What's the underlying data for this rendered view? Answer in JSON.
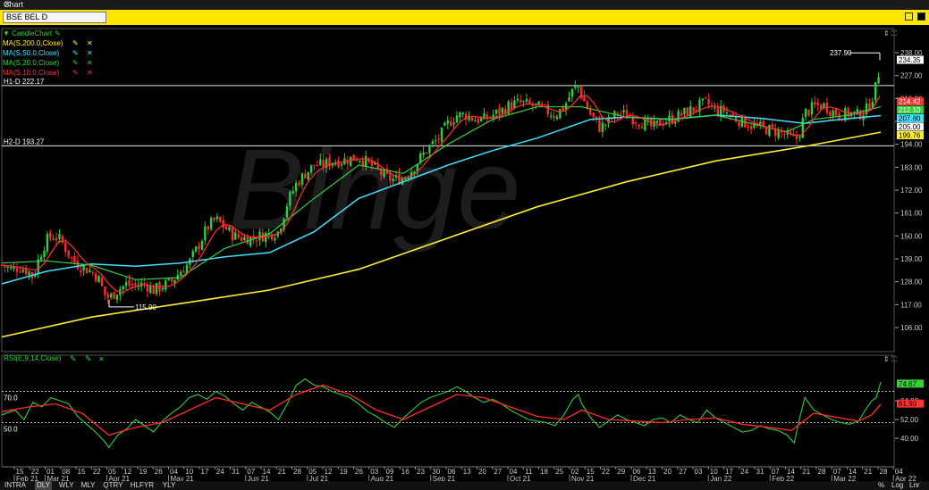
{
  "window": {
    "title": "Chart"
  },
  "symbol": "BSE BEL D",
  "watermark": "Binge",
  "legend": [
    {
      "label": "CandleChart",
      "color": "#38d038",
      "prefix": "▼"
    },
    {
      "label": "MA(S,200.0,Close)",
      "color": "#ffee33"
    },
    {
      "label": "MA(S,50.0,Close)",
      "color": "#40e0ff"
    },
    {
      "label": "MA(S,20.0,Close)",
      "color": "#38d038"
    },
    {
      "label": "MA(S,10.0,Close)",
      "color": "#ff3030"
    }
  ],
  "hlines": [
    {
      "label": "H1-D 222.17",
      "value": 222.17
    },
    {
      "label": "H2-D 193.27",
      "value": 193.27
    }
  ],
  "rsi_legend": "RSI(E,9,14,Close)",
  "rsi_levels": [
    {
      "label": "70.0",
      "value": 70
    },
    {
      "label": "50.0",
      "value": 50
    }
  ],
  "bottom": {
    "buttons": [
      "INTRA",
      "DLY",
      "WLY",
      "MLY",
      "QTRY",
      "HLFYR",
      "YLY"
    ],
    "selected": "DLY",
    "right": [
      "%",
      "Log",
      "Lnr"
    ]
  },
  "chart_data": [
    {
      "type": "candlestick",
      "title": "BSE BEL D",
      "ylim": [
        100,
        242
      ],
      "yticks": [
        "238.00",
        "227.00",
        "216.00",
        "205.00",
        "194.00",
        "183.00",
        "172.00",
        "161.00",
        "150.00",
        "139.00",
        "128.00",
        "117.00",
        "106.00"
      ],
      "price_labels": [
        {
          "text": "234.35",
          "value": 234.35,
          "bg": "#ffffff",
          "fg": "#000000"
        },
        {
          "text": "214.42",
          "value": 214.42,
          "bg": "#ff3030",
          "fg": "#ffffff"
        },
        {
          "text": "212.10",
          "value": 212.1,
          "bg": "#38d038",
          "fg": "#ffffff"
        },
        {
          "text": "207.80",
          "value": 207.8,
          "bg": "#40e0ff",
          "fg": "#000000"
        },
        {
          "text": "205.00",
          "value": 205.0,
          "bg": "#ffffff",
          "fg": "#000000"
        },
        {
          "text": "199.76",
          "value": 199.76,
          "bg": "#ffee33",
          "fg": "#000000"
        }
      ],
      "annotations": [
        {
          "text": "237.90",
          "value": 237.9
        },
        {
          "text": "115.90",
          "value": 115.9
        }
      ],
      "x_day_labels": [
        "15",
        "22",
        "01",
        "08",
        "15",
        "22",
        "05",
        "12",
        "19",
        "26",
        "04",
        "10",
        "17",
        "24",
        "31",
        "07",
        "14",
        "21",
        "28",
        "05",
        "12",
        "19",
        "26",
        "03",
        "09",
        "16",
        "23",
        "30",
        "06",
        "13",
        "20",
        "27",
        "04",
        "11",
        "18",
        "25",
        "02",
        "15",
        "22",
        "29",
        "06",
        "13",
        "20",
        "27",
        "03",
        "10",
        "17",
        "24",
        "31",
        "07",
        "14",
        "21",
        "28",
        "07",
        "14",
        "21",
        "28",
        "04"
      ],
      "x_month_labels": [
        {
          "text": "Feb 21",
          "after": 0
        },
        {
          "text": "Mar 21",
          "after": 2
        },
        {
          "text": "Apr 21",
          "after": 6
        },
        {
          "text": "May 21",
          "after": 10
        },
        {
          "text": "Jun 21",
          "after": 15
        },
        {
          "text": "Jul 21",
          "after": 19
        },
        {
          "text": "Aug 21",
          "after": 23
        },
        {
          "text": "Sep 21",
          "after": 27
        },
        {
          "text": "Oct 21",
          "after": 32
        },
        {
          "text": "Nov 21",
          "after": 36
        },
        {
          "text": "Dec 21",
          "after": 40
        },
        {
          "text": "Jan 22",
          "after": 45
        },
        {
          "text": "Feb 22",
          "after": 49
        },
        {
          "text": "Mar 22",
          "after": 53
        },
        {
          "text": "Apr 22",
          "after": 57
        }
      ],
      "close_path": [
        [
          0,
          136
        ],
        [
          10,
          134
        ],
        [
          20,
          135
        ],
        [
          30,
          133
        ],
        [
          35,
          130
        ],
        [
          42,
          140
        ],
        [
          50,
          148
        ],
        [
          58,
          150
        ],
        [
          66,
          148
        ],
        [
          74,
          142
        ],
        [
          80,
          138
        ],
        [
          90,
          135
        ],
        [
          100,
          133
        ],
        [
          108,
          130
        ],
        [
          115,
          122
        ],
        [
          120,
          120
        ],
        [
          130,
          124
        ],
        [
          140,
          127
        ],
        [
          150,
          126
        ],
        [
          160,
          127
        ],
        [
          170,
          124
        ],
        [
          180,
          126
        ],
        [
          190,
          128
        ],
        [
          200,
          133
        ],
        [
          210,
          137
        ],
        [
          220,
          145
        ],
        [
          230,
          154
        ],
        [
          240,
          158
        ],
        [
          250,
          154
        ],
        [
          260,
          150
        ],
        [
          270,
          149
        ],
        [
          280,
          149
        ],
        [
          290,
          150
        ],
        [
          300,
          151
        ],
        [
          310,
          152
        ],
        [
          320,
          166
        ],
        [
          330,
          175
        ],
        [
          340,
          180
        ],
        [
          350,
          184
        ],
        [
          360,
          184
        ],
        [
          370,
          186
        ],
        [
          380,
          186
        ],
        [
          390,
          187
        ],
        [
          400,
          188
        ],
        [
          410,
          185
        ],
        [
          420,
          182
        ],
        [
          430,
          178
        ],
        [
          440,
          177
        ],
        [
          450,
          178
        ],
        [
          460,
          182
        ],
        [
          470,
          188
        ],
        [
          480,
          193
        ],
        [
          490,
          197
        ],
        [
          500,
          204
        ],
        [
          510,
          208
        ],
        [
          520,
          208
        ],
        [
          530,
          206
        ],
        [
          540,
          206
        ],
        [
          550,
          208
        ],
        [
          560,
          210
        ],
        [
          570,
          213
        ],
        [
          580,
          214
        ],
        [
          590,
          213
        ],
        [
          600,
          212
        ],
        [
          610,
          210
        ],
        [
          620,
          208
        ],
        [
          630,
          212
        ],
        [
          640,
          220
        ],
        [
          646,
          222
        ],
        [
          650,
          217
        ],
        [
          660,
          208
        ],
        [
          670,
          202
        ],
        [
          680,
          205
        ],
        [
          690,
          209
        ],
        [
          700,
          208
        ],
        [
          710,
          206
        ],
        [
          720,
          204
        ],
        [
          730,
          202
        ],
        [
          740,
          205
        ],
        [
          750,
          206
        ],
        [
          760,
          208
        ],
        [
          770,
          210
        ],
        [
          780,
          212
        ],
        [
          790,
          214
        ],
        [
          800,
          210
        ],
        [
          810,
          210
        ],
        [
          820,
          207
        ],
        [
          830,
          205
        ],
        [
          840,
          203
        ],
        [
          850,
          202
        ],
        [
          860,
          201
        ],
        [
          870,
          200
        ],
        [
          880,
          198
        ],
        [
          890,
          196
        ],
        [
          895,
          201
        ],
        [
          900,
          209
        ],
        [
          910,
          212
        ],
        [
          920,
          213
        ],
        [
          930,
          210
        ],
        [
          940,
          208
        ],
        [
          950,
          209
        ],
        [
          960,
          208
        ],
        [
          970,
          211
        ],
        [
          975,
          216
        ],
        [
          980,
          222
        ],
        [
          985,
          234
        ]
      ],
      "ma200_path": [
        [
          0,
          101.5
        ],
        [
          100,
          111
        ],
        [
          200,
          117.5
        ],
        [
          300,
          124
        ],
        [
          400,
          134
        ],
        [
          500,
          149
        ],
        [
          600,
          164
        ],
        [
          700,
          176
        ],
        [
          800,
          186
        ],
        [
          900,
          193
        ],
        [
          985,
          199.8
        ]
      ],
      "ma50_path": [
        [
          0,
          127
        ],
        [
          50,
          133
        ],
        [
          100,
          136.5
        ],
        [
          150,
          135.5
        ],
        [
          200,
          137
        ],
        [
          250,
          140
        ],
        [
          300,
          142
        ],
        [
          350,
          152
        ],
        [
          400,
          168
        ],
        [
          450,
          176
        ],
        [
          500,
          184
        ],
        [
          550,
          191
        ],
        [
          600,
          197
        ],
        [
          660,
          206
        ],
        [
          700,
          207
        ],
        [
          750,
          206
        ],
        [
          800,
          208
        ],
        [
          850,
          206.5
        ],
        [
          900,
          204
        ],
        [
          940,
          206
        ],
        [
          985,
          207.8
        ]
      ],
      "ma20_path": [
        [
          0,
          137
        ],
        [
          50,
          138
        ],
        [
          100,
          136
        ],
        [
          150,
          129
        ],
        [
          200,
          130
        ],
        [
          250,
          144
        ],
        [
          300,
          151
        ],
        [
          350,
          168
        ],
        [
          400,
          184
        ],
        [
          450,
          180
        ],
        [
          500,
          194
        ],
        [
          550,
          206
        ],
        [
          600,
          212
        ],
        [
          650,
          212
        ],
        [
          700,
          207
        ],
        [
          750,
          206
        ],
        [
          800,
          208
        ],
        [
          850,
          203
        ],
        [
          880,
          200
        ],
        [
          910,
          206
        ],
        [
          950,
          208
        ],
        [
          985,
          212.1
        ]
      ]
    },
    {
      "type": "line",
      "title": "RSI(E,9,14,Close)",
      "ylim": [
        30,
        82
      ],
      "yticks": [
        "64.00",
        "52.00",
        "40.00"
      ],
      "price_labels": [
        {
          "text": "74.67",
          "value": 74.67,
          "bg": "#38d038",
          "fg": "#000000"
        },
        {
          "text": "61.90",
          "value": 61.9,
          "bg": "#ff3030",
          "fg": "#000000"
        }
      ],
      "rsi_path": [
        [
          0,
          55
        ],
        [
          15,
          58
        ],
        [
          25,
          52
        ],
        [
          35,
          63
        ],
        [
          45,
          60
        ],
        [
          55,
          66
        ],
        [
          65,
          64
        ],
        [
          75,
          62
        ],
        [
          85,
          54
        ],
        [
          95,
          49
        ],
        [
          105,
          44
        ],
        [
          115,
          38
        ],
        [
          120,
          34
        ],
        [
          130,
          42
        ],
        [
          140,
          46
        ],
        [
          150,
          52
        ],
        [
          160,
          48
        ],
        [
          170,
          44
        ],
        [
          180,
          51
        ],
        [
          190,
          56
        ],
        [
          200,
          60
        ],
        [
          210,
          66
        ],
        [
          220,
          68
        ],
        [
          230,
          65
        ],
        [
          240,
          70
        ],
        [
          250,
          67
        ],
        [
          260,
          62
        ],
        [
          270,
          58
        ],
        [
          280,
          63
        ],
        [
          290,
          60
        ],
        [
          300,
          57
        ],
        [
          310,
          52
        ],
        [
          320,
          62
        ],
        [
          330,
          74
        ],
        [
          340,
          78
        ],
        [
          350,
          74
        ],
        [
          360,
          73
        ],
        [
          370,
          70
        ],
        [
          380,
          68
        ],
        [
          390,
          66
        ],
        [
          400,
          62
        ],
        [
          410,
          57
        ],
        [
          420,
          54
        ],
        [
          430,
          50
        ],
        [
          440,
          47
        ],
        [
          450,
          53
        ],
        [
          460,
          58
        ],
        [
          470,
          63
        ],
        [
          480,
          66
        ],
        [
          490,
          68
        ],
        [
          500,
          70
        ],
        [
          510,
          73
        ],
        [
          520,
          70
        ],
        [
          530,
          66
        ],
        [
          540,
          63
        ],
        [
          550,
          65
        ],
        [
          560,
          62
        ],
        [
          570,
          58
        ],
        [
          580,
          55
        ],
        [
          590,
          52
        ],
        [
          600,
          51
        ],
        [
          610,
          50
        ],
        [
          620,
          48
        ],
        [
          630,
          55
        ],
        [
          640,
          65
        ],
        [
          646,
          68
        ],
        [
          650,
          62
        ],
        [
          660,
          53
        ],
        [
          670,
          47
        ],
        [
          680,
          51
        ],
        [
          690,
          55
        ],
        [
          700,
          52
        ],
        [
          710,
          50
        ],
        [
          720,
          48
        ],
        [
          730,
          52
        ],
        [
          740,
          53
        ],
        [
          750,
          50
        ],
        [
          760,
          55
        ],
        [
          770,
          52
        ],
        [
          780,
          50
        ],
        [
          790,
          58
        ],
        [
          800,
          53
        ],
        [
          810,
          50
        ],
        [
          820,
          47
        ],
        [
          830,
          44
        ],
        [
          840,
          45
        ],
        [
          850,
          48
        ],
        [
          860,
          46
        ],
        [
          870,
          45
        ],
        [
          880,
          42
        ],
        [
          888,
          37
        ],
        [
          895,
          55
        ],
        [
          900,
          66
        ],
        [
          910,
          58
        ],
        [
          920,
          55
        ],
        [
          930,
          52
        ],
        [
          940,
          50
        ],
        [
          950,
          49
        ],
        [
          960,
          51
        ],
        [
          970,
          60
        ],
        [
          975,
          64
        ],
        [
          980,
          66
        ],
        [
          985,
          76
        ]
      ],
      "signal_path": [
        [
          0,
          57
        ],
        [
          30,
          60
        ],
        [
          60,
          62
        ],
        [
          90,
          56
        ],
        [
          120,
          42
        ],
        [
          150,
          47
        ],
        [
          180,
          50
        ],
        [
          210,
          58
        ],
        [
          240,
          66
        ],
        [
          270,
          62
        ],
        [
          300,
          58
        ],
        [
          330,
          68
        ],
        [
          360,
          74
        ],
        [
          390,
          68
        ],
        [
          420,
          58
        ],
        [
          450,
          52
        ],
        [
          480,
          60
        ],
        [
          510,
          68
        ],
        [
          540,
          66
        ],
        [
          570,
          60
        ],
        [
          600,
          54
        ],
        [
          630,
          52
        ],
        [
          650,
          58
        ],
        [
          680,
          52
        ],
        [
          710,
          51
        ],
        [
          740,
          50
        ],
        [
          770,
          52
        ],
        [
          800,
          53
        ],
        [
          830,
          49
        ],
        [
          860,
          47
        ],
        [
          885,
          45
        ],
        [
          910,
          56
        ],
        [
          940,
          53
        ],
        [
          960,
          51
        ],
        [
          975,
          55
        ],
        [
          985,
          61.9
        ]
      ]
    }
  ]
}
